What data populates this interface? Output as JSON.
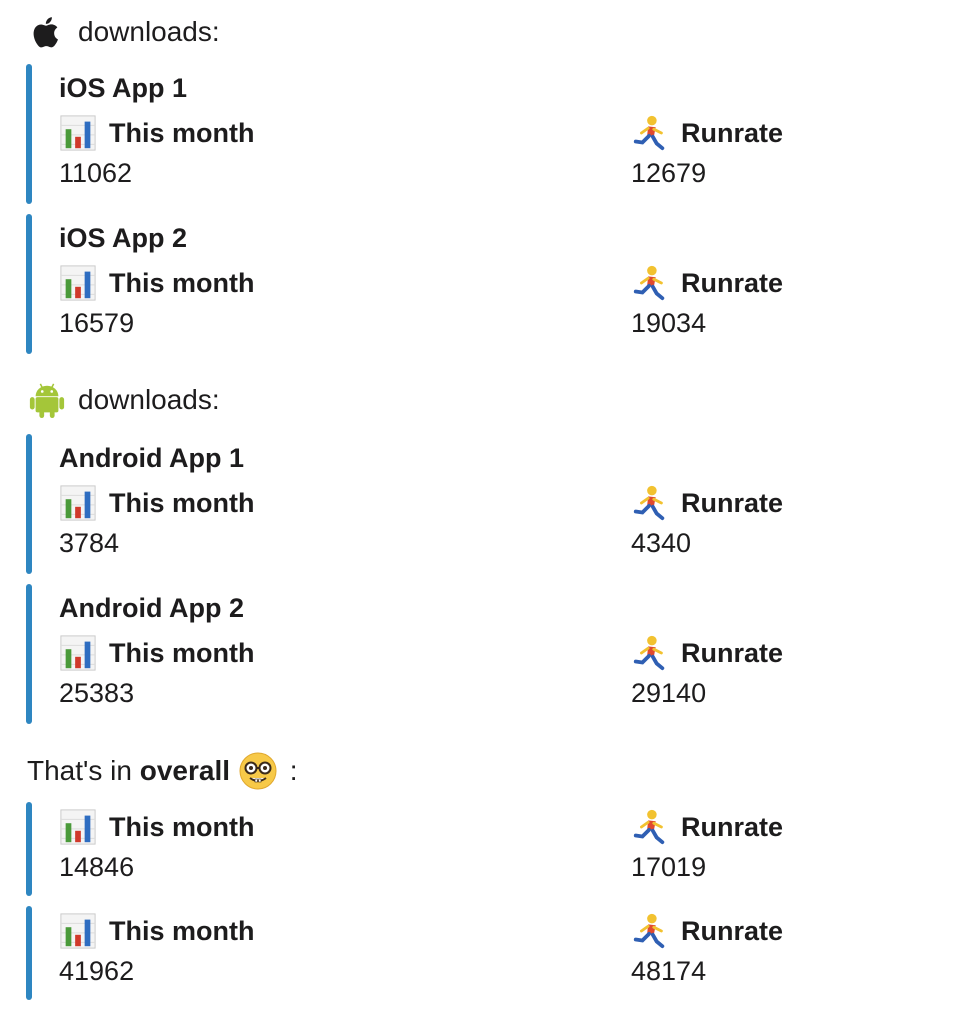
{
  "ios_section": {
    "label": "downloads:",
    "icon": "apple-logo-icon"
  },
  "android_section": {
    "label": "downloads:",
    "icon": "android-logo-icon"
  },
  "overall_section": {
    "prefix": "That's in ",
    "bold": "overall",
    "suffix": " :",
    "icon": "nerd-face-icon"
  },
  "field_labels": {
    "this_month": "This month",
    "runrate": "Runrate"
  },
  "apps": [
    {
      "title": "iOS App 1",
      "this_month": "11062",
      "runrate": "12679"
    },
    {
      "title": "iOS App 2",
      "this_month": "16579",
      "runrate": "19034"
    },
    {
      "title": "Android App 1",
      "this_month": "3784",
      "runrate": "4340"
    },
    {
      "title": "Android App 2",
      "this_month": "25383",
      "runrate": "29140"
    }
  ],
  "overall": [
    {
      "this_month": "14846",
      "runrate": "17019"
    },
    {
      "this_month": "41962",
      "runrate": "48174"
    }
  ],
  "colors": {
    "accent_bar": "#2e86c1",
    "android_green": "#a4c639"
  }
}
